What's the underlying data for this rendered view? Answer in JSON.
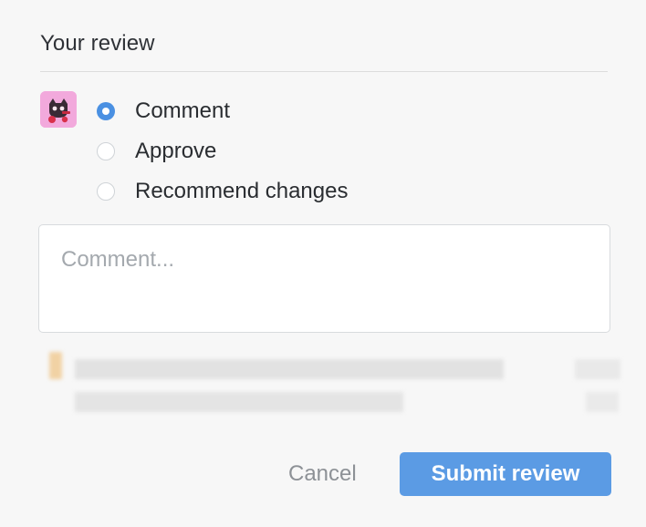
{
  "review": {
    "title": "Your review",
    "options": [
      {
        "label": "Comment",
        "checked": true
      },
      {
        "label": "Approve",
        "checked": false
      },
      {
        "label": "Recommend changes",
        "checked": false
      }
    ],
    "comment_placeholder": "Comment..."
  },
  "actions": {
    "cancel_label": "Cancel",
    "submit_label": "Submit review"
  },
  "colors": {
    "accent": "#4a90e2",
    "submit_bg": "#5b9be4",
    "avatar_bg": "#f2a9dc"
  }
}
